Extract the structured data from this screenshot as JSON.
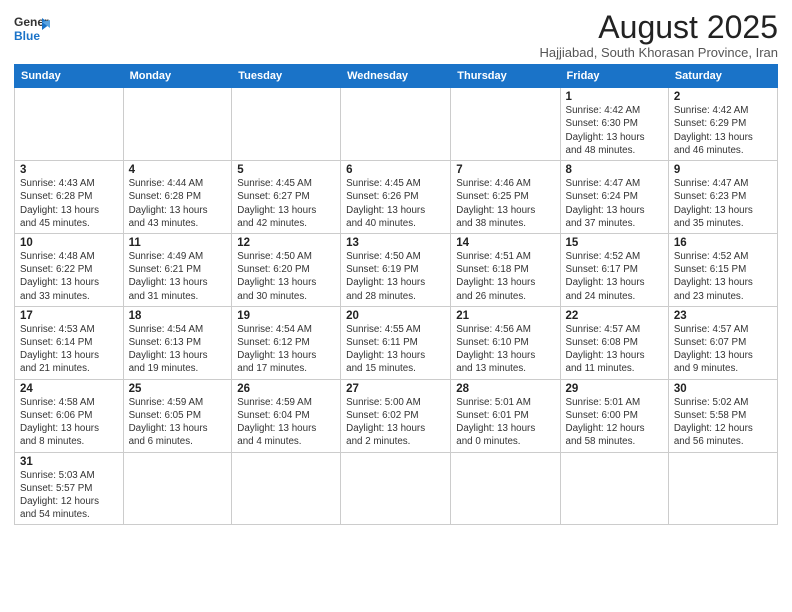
{
  "header": {
    "logo_general": "General",
    "logo_blue": "Blue",
    "month_title": "August 2025",
    "subtitle": "Hajjiabad, South Khorasan Province, Iran"
  },
  "weekdays": [
    "Sunday",
    "Monday",
    "Tuesday",
    "Wednesday",
    "Thursday",
    "Friday",
    "Saturday"
  ],
  "weeks": [
    {
      "days": [
        {
          "num": "",
          "info": ""
        },
        {
          "num": "",
          "info": ""
        },
        {
          "num": "",
          "info": ""
        },
        {
          "num": "",
          "info": ""
        },
        {
          "num": "",
          "info": ""
        },
        {
          "num": "1",
          "info": "Sunrise: 4:42 AM\nSunset: 6:30 PM\nDaylight: 13 hours\nand 48 minutes."
        },
        {
          "num": "2",
          "info": "Sunrise: 4:42 AM\nSunset: 6:29 PM\nDaylight: 13 hours\nand 46 minutes."
        }
      ]
    },
    {
      "days": [
        {
          "num": "3",
          "info": "Sunrise: 4:43 AM\nSunset: 6:28 PM\nDaylight: 13 hours\nand 45 minutes."
        },
        {
          "num": "4",
          "info": "Sunrise: 4:44 AM\nSunset: 6:28 PM\nDaylight: 13 hours\nand 43 minutes."
        },
        {
          "num": "5",
          "info": "Sunrise: 4:45 AM\nSunset: 6:27 PM\nDaylight: 13 hours\nand 42 minutes."
        },
        {
          "num": "6",
          "info": "Sunrise: 4:45 AM\nSunset: 6:26 PM\nDaylight: 13 hours\nand 40 minutes."
        },
        {
          "num": "7",
          "info": "Sunrise: 4:46 AM\nSunset: 6:25 PM\nDaylight: 13 hours\nand 38 minutes."
        },
        {
          "num": "8",
          "info": "Sunrise: 4:47 AM\nSunset: 6:24 PM\nDaylight: 13 hours\nand 37 minutes."
        },
        {
          "num": "9",
          "info": "Sunrise: 4:47 AM\nSunset: 6:23 PM\nDaylight: 13 hours\nand 35 minutes."
        }
      ]
    },
    {
      "days": [
        {
          "num": "10",
          "info": "Sunrise: 4:48 AM\nSunset: 6:22 PM\nDaylight: 13 hours\nand 33 minutes."
        },
        {
          "num": "11",
          "info": "Sunrise: 4:49 AM\nSunset: 6:21 PM\nDaylight: 13 hours\nand 31 minutes."
        },
        {
          "num": "12",
          "info": "Sunrise: 4:50 AM\nSunset: 6:20 PM\nDaylight: 13 hours\nand 30 minutes."
        },
        {
          "num": "13",
          "info": "Sunrise: 4:50 AM\nSunset: 6:19 PM\nDaylight: 13 hours\nand 28 minutes."
        },
        {
          "num": "14",
          "info": "Sunrise: 4:51 AM\nSunset: 6:18 PM\nDaylight: 13 hours\nand 26 minutes."
        },
        {
          "num": "15",
          "info": "Sunrise: 4:52 AM\nSunset: 6:17 PM\nDaylight: 13 hours\nand 24 minutes."
        },
        {
          "num": "16",
          "info": "Sunrise: 4:52 AM\nSunset: 6:15 PM\nDaylight: 13 hours\nand 23 minutes."
        }
      ]
    },
    {
      "days": [
        {
          "num": "17",
          "info": "Sunrise: 4:53 AM\nSunset: 6:14 PM\nDaylight: 13 hours\nand 21 minutes."
        },
        {
          "num": "18",
          "info": "Sunrise: 4:54 AM\nSunset: 6:13 PM\nDaylight: 13 hours\nand 19 minutes."
        },
        {
          "num": "19",
          "info": "Sunrise: 4:54 AM\nSunset: 6:12 PM\nDaylight: 13 hours\nand 17 minutes."
        },
        {
          "num": "20",
          "info": "Sunrise: 4:55 AM\nSunset: 6:11 PM\nDaylight: 13 hours\nand 15 minutes."
        },
        {
          "num": "21",
          "info": "Sunrise: 4:56 AM\nSunset: 6:10 PM\nDaylight: 13 hours\nand 13 minutes."
        },
        {
          "num": "22",
          "info": "Sunrise: 4:57 AM\nSunset: 6:08 PM\nDaylight: 13 hours\nand 11 minutes."
        },
        {
          "num": "23",
          "info": "Sunrise: 4:57 AM\nSunset: 6:07 PM\nDaylight: 13 hours\nand 9 minutes."
        }
      ]
    },
    {
      "days": [
        {
          "num": "24",
          "info": "Sunrise: 4:58 AM\nSunset: 6:06 PM\nDaylight: 13 hours\nand 8 minutes."
        },
        {
          "num": "25",
          "info": "Sunrise: 4:59 AM\nSunset: 6:05 PM\nDaylight: 13 hours\nand 6 minutes."
        },
        {
          "num": "26",
          "info": "Sunrise: 4:59 AM\nSunset: 6:04 PM\nDaylight: 13 hours\nand 4 minutes."
        },
        {
          "num": "27",
          "info": "Sunrise: 5:00 AM\nSunset: 6:02 PM\nDaylight: 13 hours\nand 2 minutes."
        },
        {
          "num": "28",
          "info": "Sunrise: 5:01 AM\nSunset: 6:01 PM\nDaylight: 13 hours\nand 0 minutes."
        },
        {
          "num": "29",
          "info": "Sunrise: 5:01 AM\nSunset: 6:00 PM\nDaylight: 12 hours\nand 58 minutes."
        },
        {
          "num": "30",
          "info": "Sunrise: 5:02 AM\nSunset: 5:58 PM\nDaylight: 12 hours\nand 56 minutes."
        }
      ]
    },
    {
      "days": [
        {
          "num": "31",
          "info": "Sunrise: 5:03 AM\nSunset: 5:57 PM\nDaylight: 12 hours\nand 54 minutes."
        },
        {
          "num": "",
          "info": ""
        },
        {
          "num": "",
          "info": ""
        },
        {
          "num": "",
          "info": ""
        },
        {
          "num": "",
          "info": ""
        },
        {
          "num": "",
          "info": ""
        },
        {
          "num": "",
          "info": ""
        }
      ]
    }
  ]
}
